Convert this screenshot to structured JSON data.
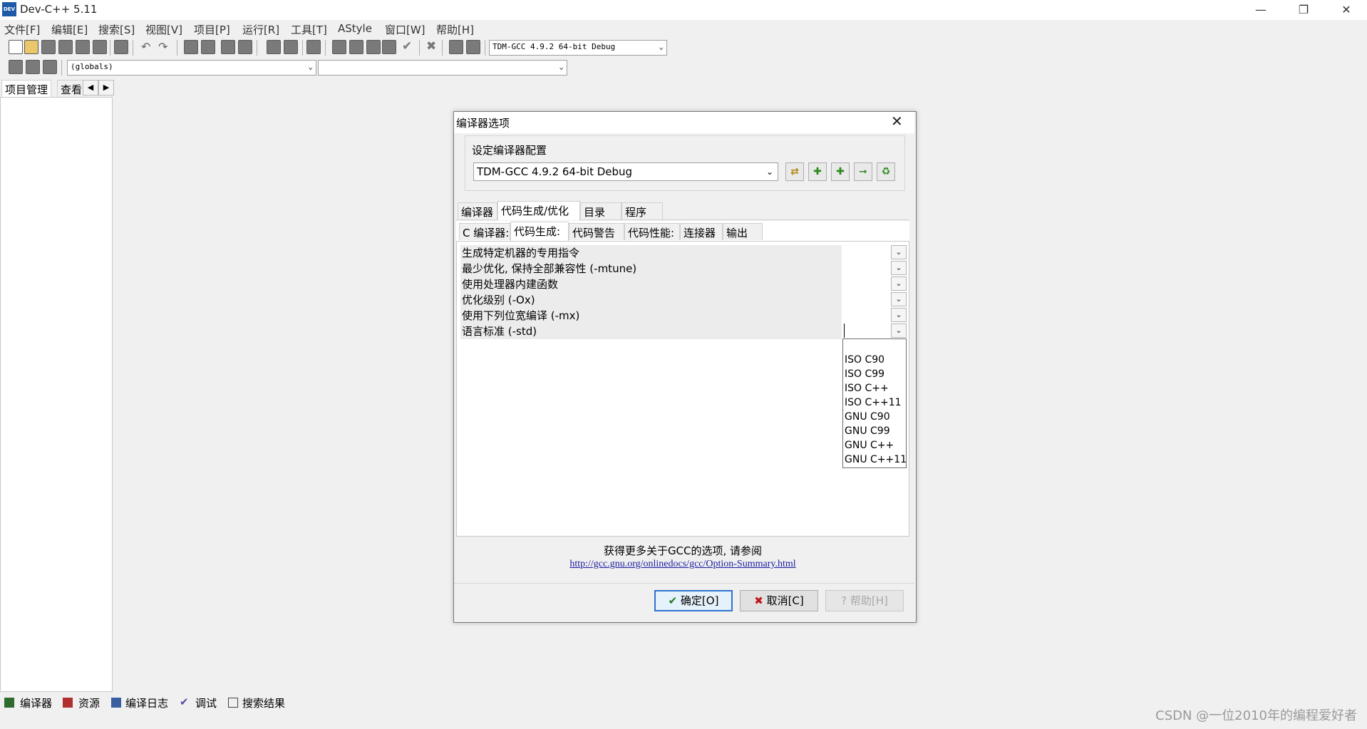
{
  "window": {
    "title": "Dev-C++ 5.11",
    "icon_label": "DEV"
  },
  "menu": [
    "文件[F]",
    "编辑[E]",
    "搜索[S]",
    "视图[V]",
    "项目[P]",
    "运行[R]",
    "工具[T]",
    "AStyle",
    "窗口[W]",
    "帮助[H]"
  ],
  "toolbar": {
    "compiler_select": "TDM-GCC 4.9.2 64-bit Debug",
    "scope_select": "(globals)",
    "member_select": ""
  },
  "left_panel": {
    "tabs": [
      "项目管理",
      "查看"
    ]
  },
  "bottom_tabs": [
    "编译器",
    "资源",
    "编译日志",
    "调试",
    "搜索结果"
  ],
  "dialog": {
    "title": "编译器选项",
    "group_label": "设定编译器配置",
    "config_value": "TDM-GCC 4.9.2 64-bit Debug",
    "main_tabs": [
      "编译器",
      "代码生成/优化",
      "目录",
      "程序"
    ],
    "sub_tabs": [
      "C 编译器:",
      "代码生成:",
      "代码警告",
      "代码性能:",
      "连接器",
      "输出"
    ],
    "options": [
      "生成特定机器的专用指令",
      "最少优化, 保持全部兼容性 (-mtune)",
      "使用处理器内建函数",
      "优化级别 (-Ox)",
      "使用下列位宽编译 (-mx)",
      "语言标准 (-std)"
    ],
    "std_options": [
      "ISO C90",
      "ISO C99",
      "ISO C++",
      "ISO C++11",
      "GNU C90",
      "GNU C99",
      "GNU C++",
      "GNU C++11"
    ],
    "info_text": "获得更多关于GCC的选项, 请参阅",
    "link": "http://gcc.gnu.org/onlinedocs/gcc/Option-Summary.html",
    "ok_label": "确定[O]",
    "cancel_label": "取消[C]",
    "help_label": "帮助[H]"
  },
  "watermark": "CSDN @一位2010年的编程爱好者"
}
